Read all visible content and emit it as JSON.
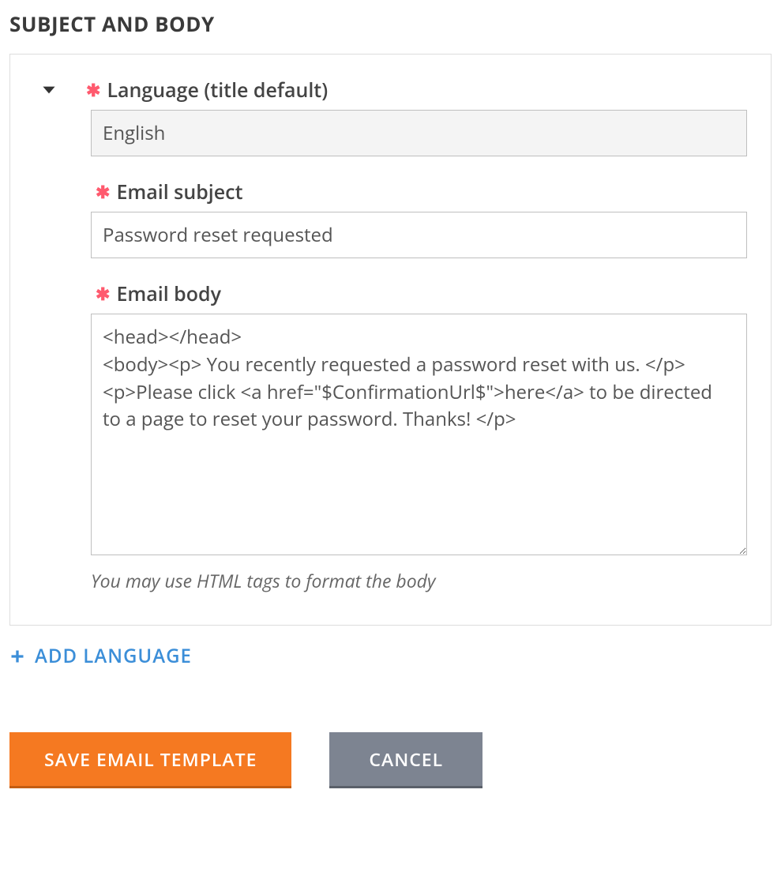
{
  "section_title": "SUBJECT AND BODY",
  "fields": {
    "language": {
      "label": "Language (title default)",
      "value": "English"
    },
    "subject": {
      "label": "Email subject",
      "value": "Password reset requested"
    },
    "body": {
      "label": "Email body",
      "value": "<head></head>\n<body><p> You recently requested a password reset with us. </p>\n<p>Please click <a href=\"$ConfirmationUrl$\">here</a> to be directed to a page to reset your password. Thanks! </p>",
      "hint": "You may use HTML tags to format the body"
    }
  },
  "actions": {
    "add_language": "ADD LANGUAGE",
    "save": "SAVE EMAIL TEMPLATE",
    "cancel": "CANCEL"
  }
}
